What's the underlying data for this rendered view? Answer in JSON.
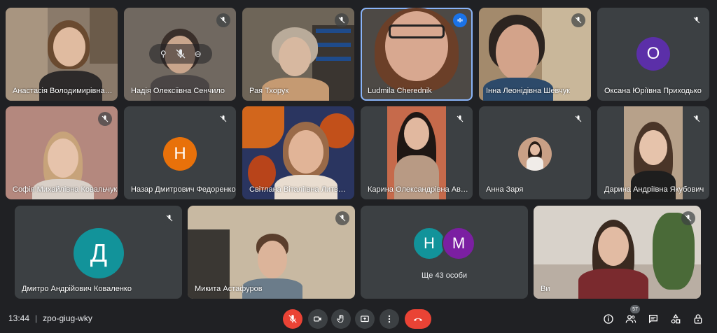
{
  "participants": [
    {
      "name": "Анастасія Володимирівна Сі..."
    },
    {
      "name": "Надія Олексіівна Сенчило"
    },
    {
      "name": "Рая Тхорук"
    },
    {
      "name": "Ludmila Cherednik"
    },
    {
      "name": "Інна Леонідівна Шевчук"
    },
    {
      "name": "Оксана Юріївна Приходько",
      "initial": "О",
      "color": "#5b2fa8"
    },
    {
      "name": "Софія Михайлівна Ковальчук"
    },
    {
      "name": "Назар Дмитрович Федоренко",
      "initial": "Н",
      "color": "#e8710a"
    },
    {
      "name": "Світлана Віталіївна Литвинс..."
    },
    {
      "name": "Карина Олександрівна Авд..."
    },
    {
      "name": "Анна Заря"
    },
    {
      "name": "Дарина Андріївна Якубович"
    },
    {
      "name": "Дмитро Андрійович Коваленко",
      "initial": "Д",
      "color": "#12939a"
    },
    {
      "name": "Микита Астафуров"
    },
    {
      "name": "Ви"
    }
  ],
  "others": {
    "label": "Ще 43 особи",
    "initials": [
      "Н",
      "М"
    ],
    "colors": [
      "#12939a",
      "#7b1fa2"
    ]
  },
  "meeting": {
    "time": "13:44",
    "separator": "|",
    "code": "zpo-giug-wky"
  },
  "controls": {
    "people_count": "57",
    "icons": [
      "mic-off-icon",
      "camera-icon",
      "raise-hand-icon",
      "present-icon",
      "more-icon",
      "end-call-icon",
      "info-icon",
      "people-icon",
      "chat-icon",
      "activities-icon",
      "host-controls-icon"
    ]
  },
  "colors": {
    "background": "#202124",
    "tile": "#3c4043",
    "accent_red": "#ea4335",
    "speaking_outline": "#8ab4f8"
  }
}
